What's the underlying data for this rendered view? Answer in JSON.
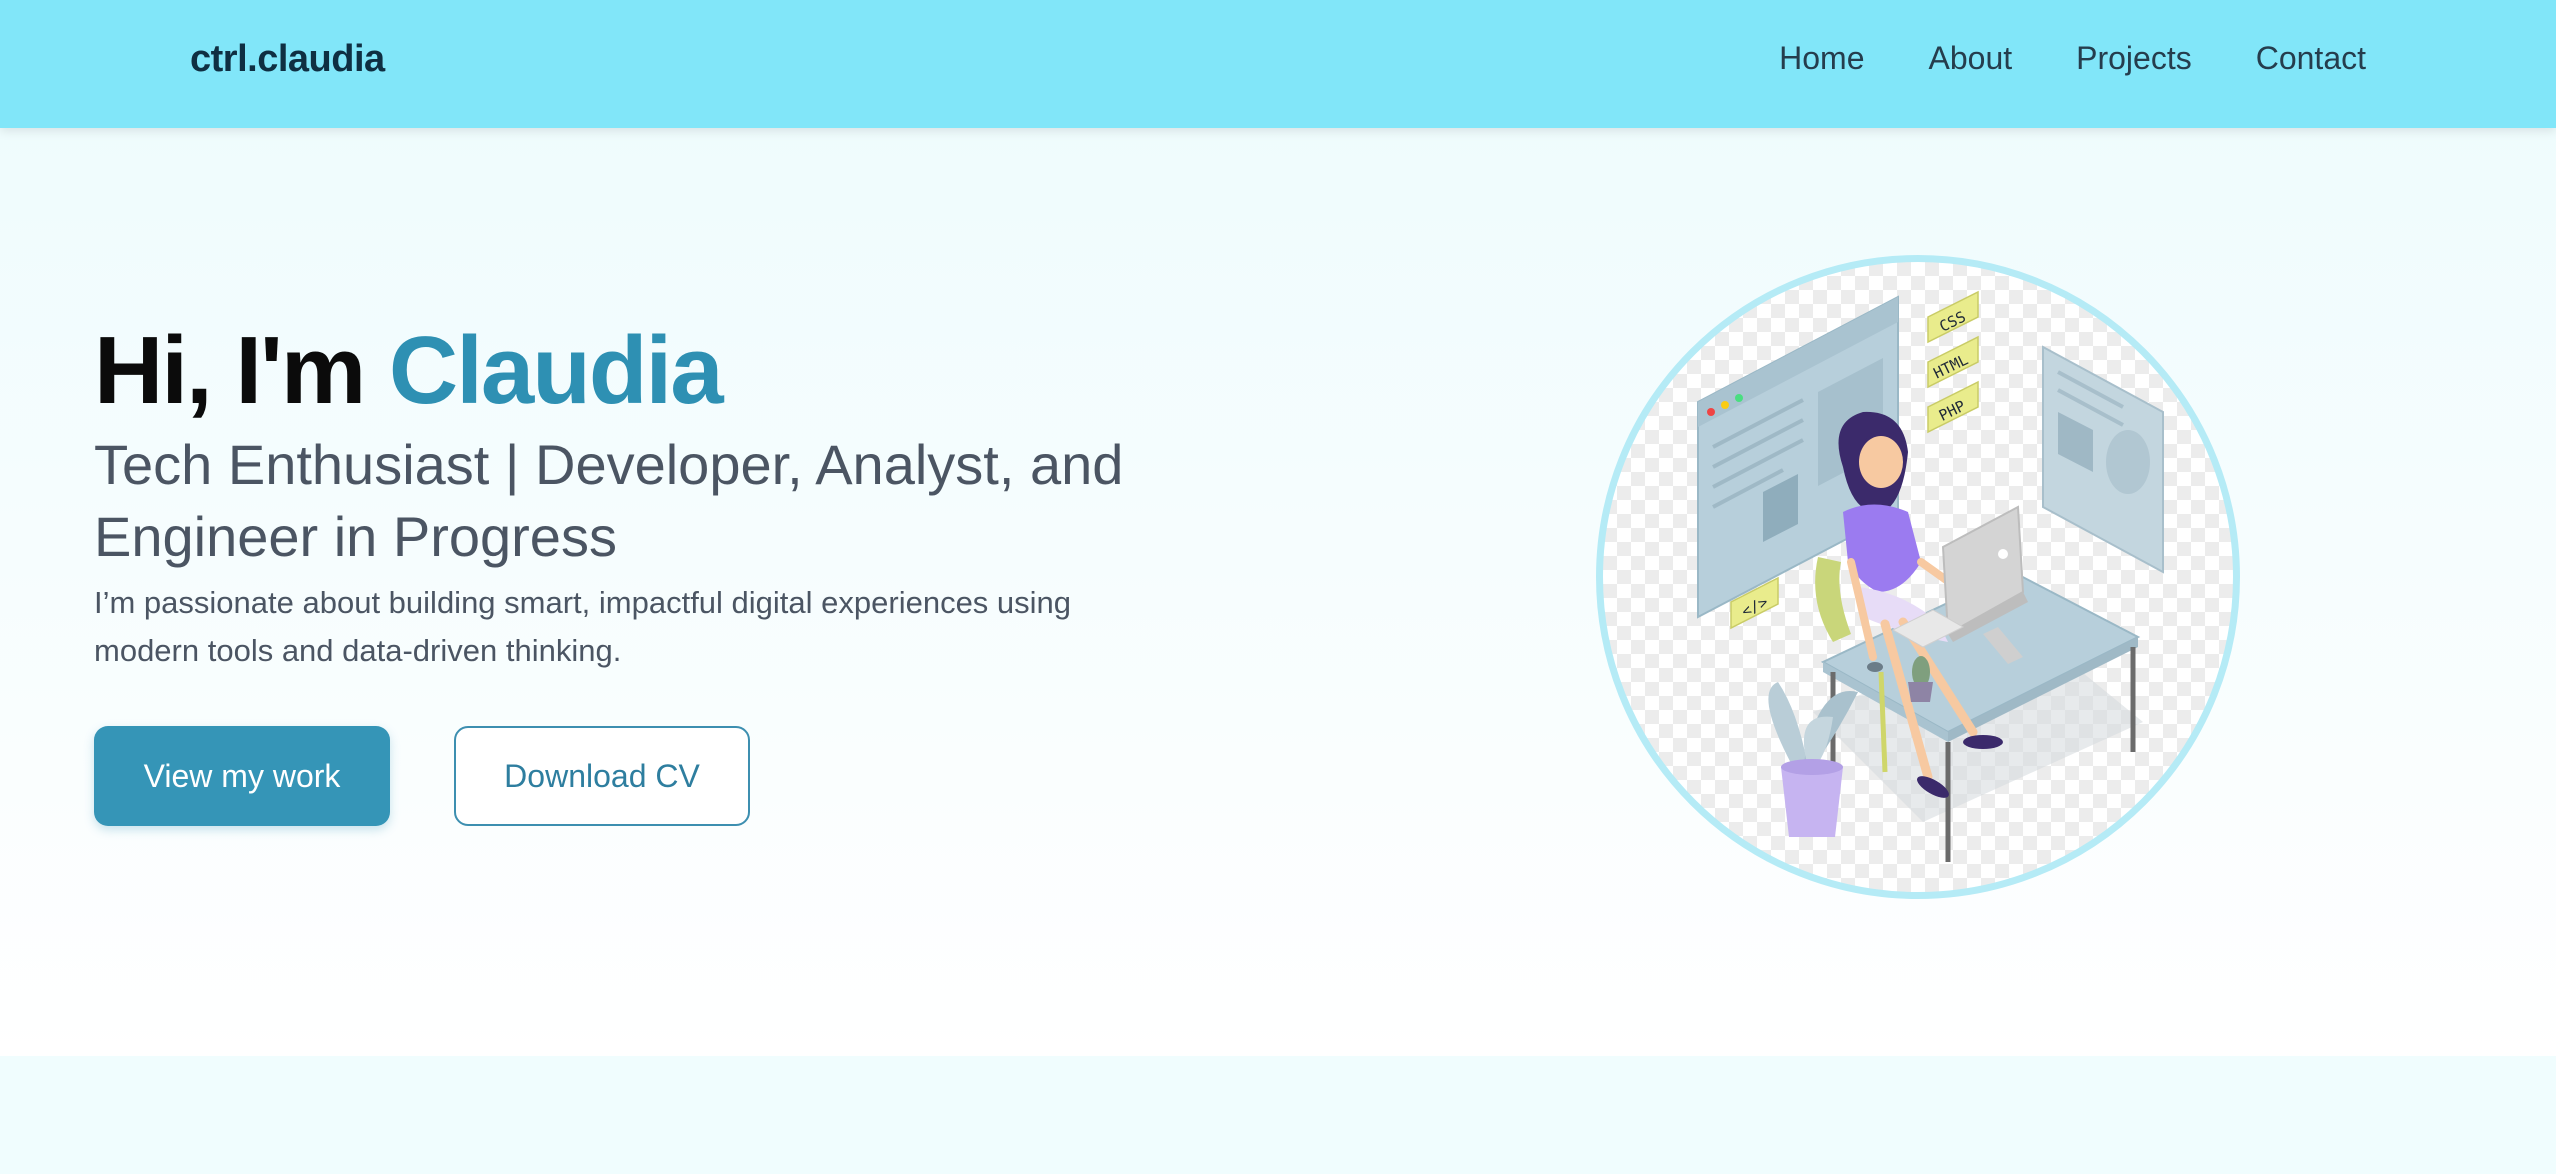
{
  "nav": {
    "brand": "ctrl.claudia",
    "links": [
      "Home",
      "About",
      "Projects",
      "Contact"
    ]
  },
  "hero": {
    "greeting": "Hi, I'm",
    "name": "Claudia",
    "subtitle": "Tech Enthusiast | Developer, Analyst, and Engineer in Progress",
    "description": "I’m passionate about building smart, impactful digital experiences using modern tools and data-driven thinking.",
    "primary_button": "View my work",
    "secondary_button": "Download CV"
  },
  "illustration": {
    "tags": [
      "CSS",
      "HTML",
      "PHP",
      "</>"
    ]
  },
  "colors": {
    "navbar_bg": "#81e6f9",
    "accent": "#2e90b3",
    "primary_button": "#3595b7",
    "hero_bg": "#effcfd"
  }
}
